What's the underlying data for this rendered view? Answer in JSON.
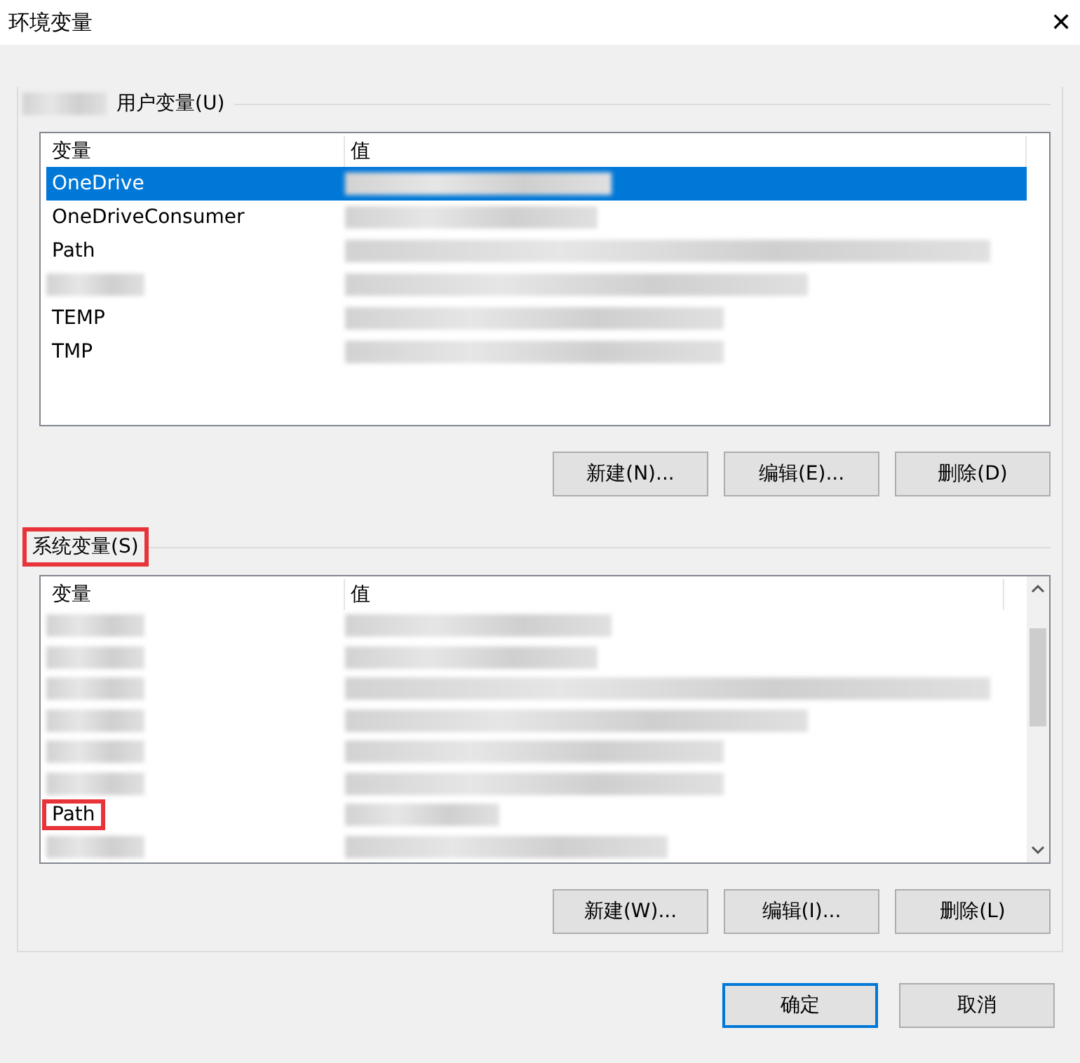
{
  "window": {
    "title": "环境变量",
    "close": "✕"
  },
  "user_vars": {
    "label": "用户变量(U)",
    "columns": [
      "变量",
      "值"
    ],
    "rows": [
      {
        "name": "OneDrive",
        "selected": true
      },
      {
        "name": "OneDriveConsumer",
        "selected": false
      },
      {
        "name": "Path",
        "selected": false
      },
      {
        "selected": false
      },
      {
        "name": "TEMP",
        "selected": false
      },
      {
        "name": "TMP",
        "selected": false
      }
    ],
    "buttons": [
      "新建(N)...",
      "编辑(E)...",
      "删除(D)"
    ]
  },
  "system_vars": {
    "label": "系统变量(S)",
    "highlighted": true,
    "columns": [
      "变量",
      "值"
    ],
    "rows": [
      {
        "selected": false,
        "highlighted": false
      },
      {
        "selected": false,
        "highlighted": false
      },
      {
        "selected": false,
        "highlighted": false
      },
      {
        "selected": false,
        "highlighted": false
      },
      {
        "selected": false,
        "highlighted": false
      },
      {
        "selected": false,
        "highlighted": false
      },
      {
        "name": "Path",
        "selected": false,
        "highlighted": true
      },
      {
        "selected": false,
        "highlighted": false
      }
    ],
    "buttons": [
      "新建(W)...",
      "编辑(I)...",
      "删除(L)"
    ]
  },
  "buttons": [
    {
      "label": "确定",
      "default": true
    },
    {
      "label": "取消",
      "default": false
    }
  ]
}
